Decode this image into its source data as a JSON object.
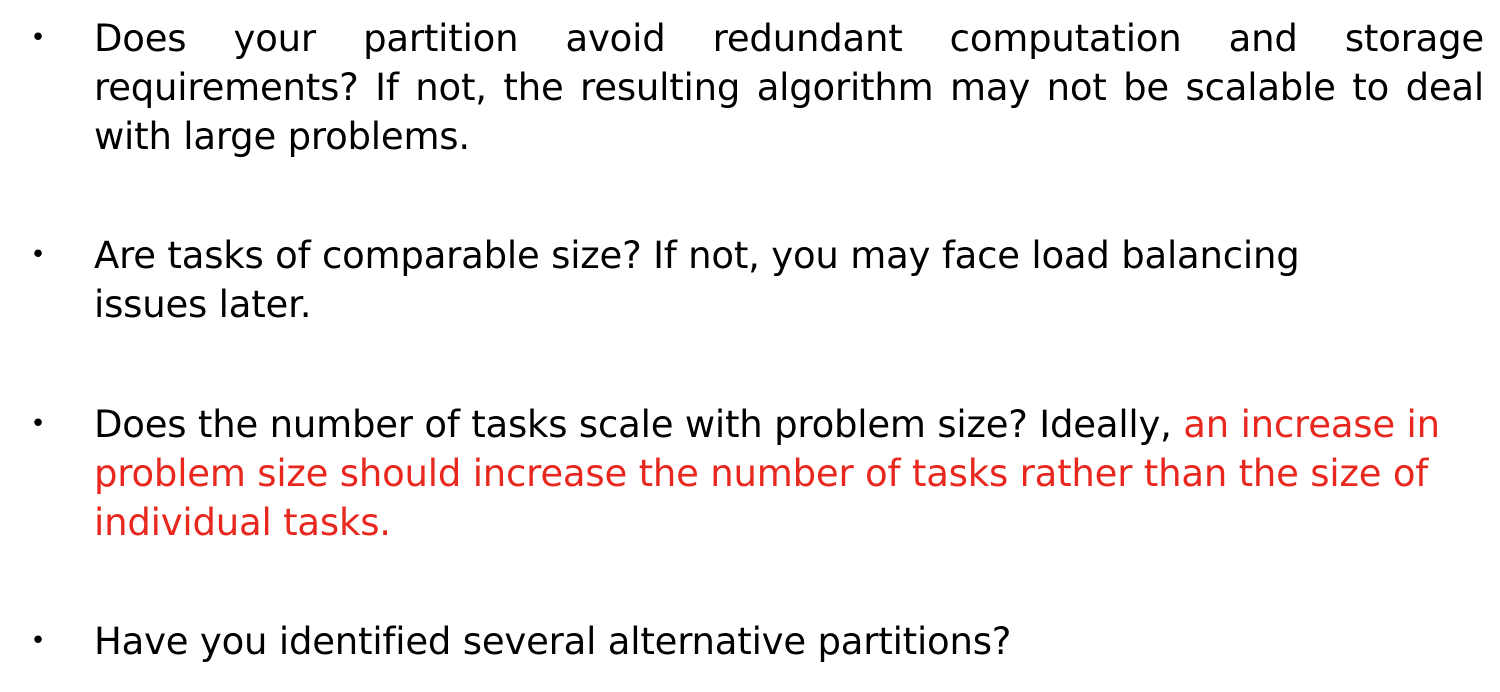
{
  "slide": {
    "bullets": [
      {
        "text": "Does your partition avoid redundant computation and storage requirements? If not, the resulting algorithm may not be scalable to deal with large problems."
      },
      {
        "text": "Are tasks of comparable size? If not, you may face load balancing issues later."
      },
      {
        "text_plain": "Does the number of tasks scale with problem size? Ideally, ",
        "text_highlight": "an increase in problem size should increase the number of tasks rather than the size of individual tasks.",
        "highlight_color": "#e8271e"
      },
      {
        "text": "Have you identified several alternative partitions?"
      }
    ],
    "bullet_symbol": "•"
  }
}
